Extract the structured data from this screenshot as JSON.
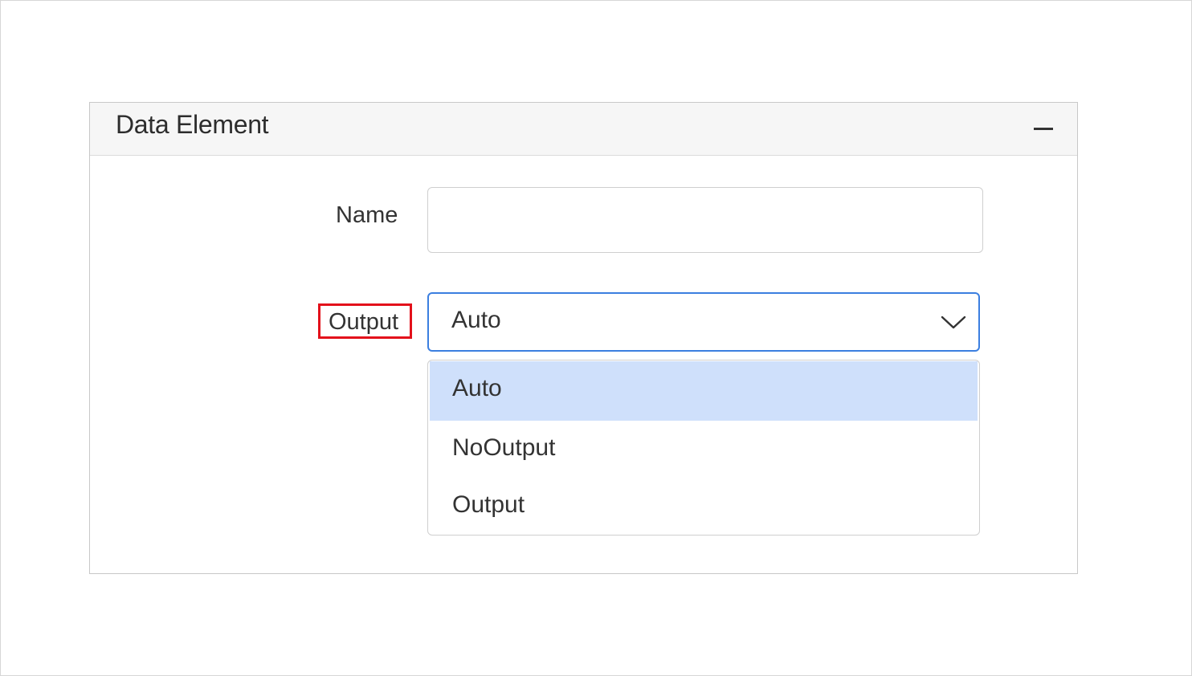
{
  "panel": {
    "title": "Data Element",
    "collapse_icon": "minus-icon"
  },
  "fields": {
    "name": {
      "label": "Name",
      "value": "",
      "placeholder": ""
    },
    "output": {
      "label": "Output",
      "selected_value": "Auto",
      "dropdown_icon": "chevron-down-icon",
      "options": [
        {
          "label": "Auto",
          "selected": true
        },
        {
          "label": "NoOutput",
          "selected": false
        },
        {
          "label": "Output",
          "selected": false
        }
      ]
    }
  },
  "colors": {
    "highlight_box": "#e3111b",
    "focus_border": "#3b7fe0",
    "selected_option_bg": "#cfe0fb"
  }
}
